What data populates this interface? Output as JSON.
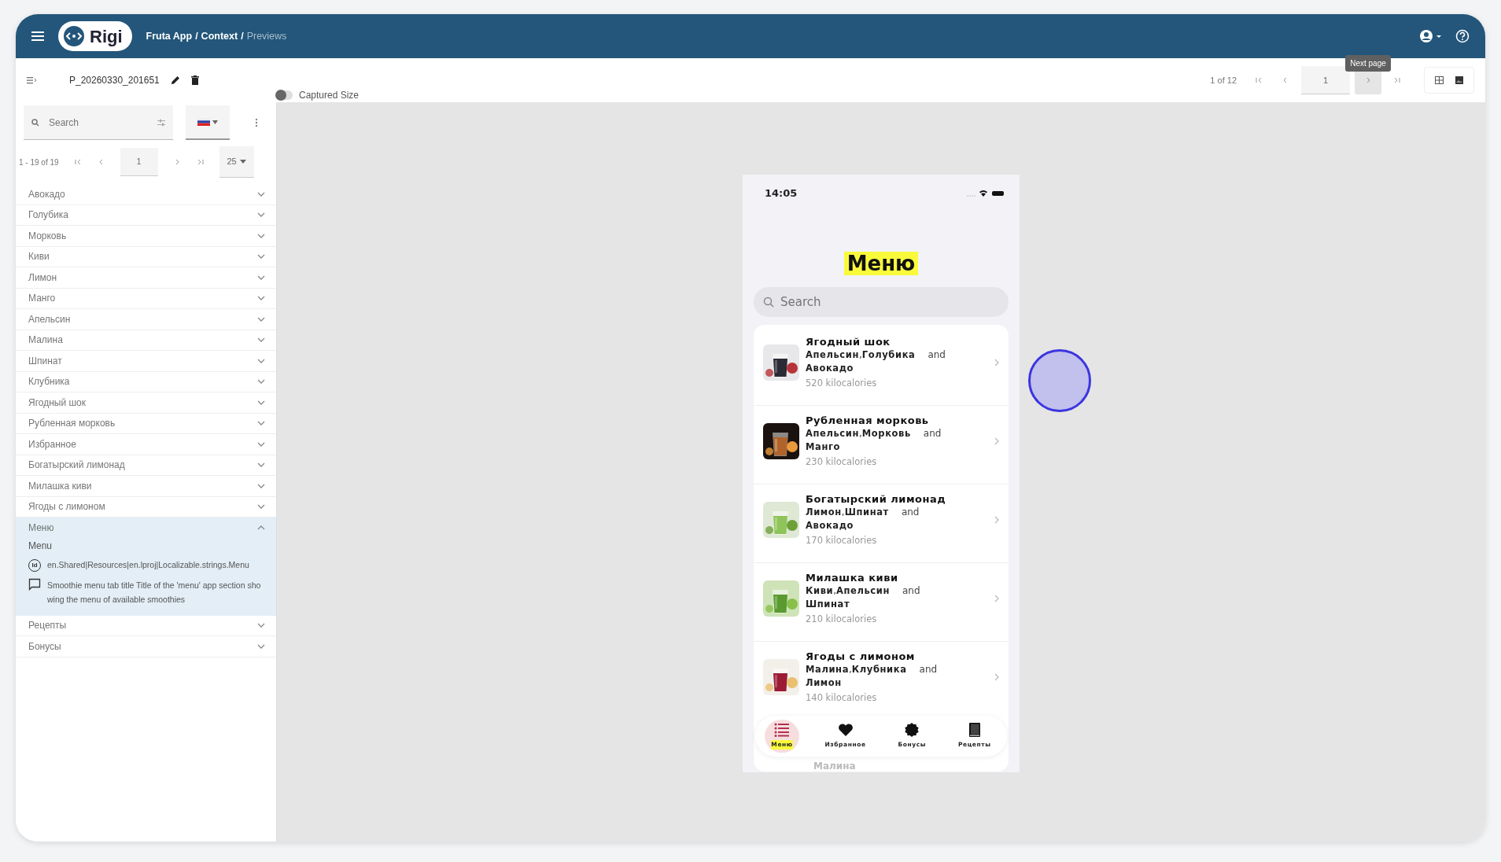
{
  "topbar": {
    "logo": "Rigi",
    "breadcrumb": [
      {
        "label": "Fruta App",
        "current": false,
        "separator": "/"
      },
      {
        "label": "Context",
        "current": false,
        "separator": "/"
      },
      {
        "label": "Previews",
        "current": true
      }
    ]
  },
  "toolbar": {
    "file_name": "P_20260330_201651",
    "captured_size": {
      "label": "Captured Size",
      "on": false
    },
    "pager": {
      "summary": "1 of 12",
      "page": "1",
      "tooltip": "Next page"
    }
  },
  "sidebar": {
    "search": {
      "placeholder": "Search"
    },
    "pager": {
      "summary": "1 - 19 of 19",
      "page": "1",
      "page_size": "25"
    },
    "items": [
      {
        "label": "Авокадо",
        "expanded": false
      },
      {
        "label": "Голубика",
        "expanded": false
      },
      {
        "label": "Морковь",
        "expanded": false
      },
      {
        "label": "Киви",
        "expanded": false
      },
      {
        "label": "Лимон",
        "expanded": false
      },
      {
        "label": "Манго",
        "expanded": false
      },
      {
        "label": "Апельсин",
        "expanded": false
      },
      {
        "label": "Малина",
        "expanded": false
      },
      {
        "label": "Шпинат",
        "expanded": false
      },
      {
        "label": "Клубника",
        "expanded": false
      },
      {
        "label": "Ягодный шок",
        "expanded": false
      },
      {
        "label": "Рубленная морковь",
        "expanded": false
      },
      {
        "label": "Избранное",
        "expanded": false
      },
      {
        "label": "Богатырский лимонад",
        "expanded": false
      },
      {
        "label": "Милашка киви",
        "expanded": false
      },
      {
        "label": "Ягоды с лимоном",
        "expanded": false
      },
      {
        "label": "Меню",
        "expanded": true,
        "details": {
          "value": "Menu",
          "id_label": "Id",
          "key": "en.Shared|Resources|en.lproj|Localizable.strings.Menu",
          "comment": "Smoothie menu tab title Title of the 'menu' app section showing the menu of available smoothies"
        }
      },
      {
        "label": "Рецепты",
        "expanded": false
      },
      {
        "label": "Бонусы",
        "expanded": false
      }
    ]
  },
  "phone": {
    "time": "14:05",
    "title": "Меню",
    "search": {
      "placeholder": "Search"
    },
    "smoothies": [
      {
        "name": "Ягодный шок",
        "first": "Апельсин",
        "comma": ",",
        "second": "Голубика",
        "conjunction": "and",
        "last": "Авокадо",
        "calories": "520 kilocalories"
      },
      {
        "name": "Рубленная морковь",
        "first": "Апельсин",
        "comma": ",",
        "second": "Морковь",
        "conjunction": "and",
        "last": "Манго",
        "calories": "230 kilocalories"
      },
      {
        "name": "Богатырский лимонад",
        "first": "Лимон",
        "comma": ",",
        "second": "Шпинат",
        "conjunction": "and",
        "last": "Авокадо",
        "calories": "170 kilocalories"
      },
      {
        "name": "Милашка киви",
        "first": "Киви",
        "comma": ",",
        "second": "Апельсин",
        "conjunction": "and",
        "last": "Шпинат",
        "calories": "210 kilocalories"
      },
      {
        "name": "Ягоды с лимоном",
        "first": "Малина",
        "comma": ",",
        "second": "Клубника",
        "conjunction": "and",
        "last": "Лимон",
        "calories": "140 kilocalories"
      }
    ],
    "peek_text": "Малина",
    "tabs": [
      {
        "label": "Меню",
        "selected": true
      },
      {
        "label": "Избранное",
        "selected": false
      },
      {
        "label": "Бонусы",
        "selected": false
      },
      {
        "label": "Рецепты",
        "selected": false
      }
    ]
  }
}
